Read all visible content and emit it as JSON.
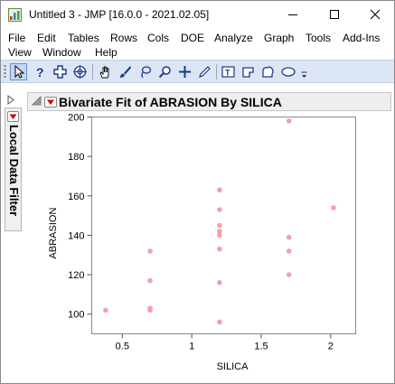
{
  "window": {
    "title": "Untitled 3 - JMP [16.0.0 - 2021.02.05]"
  },
  "menu": [
    {
      "label": "File"
    },
    {
      "label": "Edit"
    },
    {
      "label": "Tables"
    },
    {
      "label": "Rows"
    },
    {
      "label": "Cols"
    },
    {
      "label": "DOE"
    },
    {
      "label": "Analyze"
    },
    {
      "label": "Graph"
    },
    {
      "label": "Tools"
    },
    {
      "label": "Add-Ins"
    },
    {
      "label": "View"
    },
    {
      "label": "Window"
    },
    {
      "label": "Help"
    }
  ],
  "toolbar": {
    "tools": [
      "arrow-tool",
      "help-tool",
      "crosshair-tool",
      "scroller-tool",
      "grabber-tool",
      "brush-tool",
      "lasso-tool",
      "magnifier-tool",
      "crosshairs-tool",
      "line-tool",
      "annotate-tool",
      "polygon-tool",
      "simple-shape-tool",
      "ellipse-tool"
    ],
    "selected": "arrow-tool"
  },
  "side_panel": {
    "label": "Local Data Filter"
  },
  "report": {
    "title": "Bivariate Fit of ABRASION By SILICA"
  },
  "chart_data": {
    "type": "scatter",
    "xlabel": "SILICA",
    "ylabel": "ABRASION",
    "xlim": [
      0.28,
      2.18
    ],
    "ylim": [
      90,
      200
    ],
    "xticks": [
      0.5,
      1,
      1.5,
      2
    ],
    "xtick_labels": [
      "0.5",
      "1",
      "1.5",
      "2"
    ],
    "yticks": [
      100,
      120,
      140,
      160,
      180,
      200
    ],
    "ytick_labels": [
      "100",
      "120",
      "140",
      "160",
      "180",
      "200"
    ],
    "grid": false,
    "marker_color": "#f4a0aa",
    "points": [
      {
        "x": 0.38,
        "y": 102
      },
      {
        "x": 0.7,
        "y": 132
      },
      {
        "x": 0.7,
        "y": 117
      },
      {
        "x": 0.7,
        "y": 103
      },
      {
        "x": 0.7,
        "y": 102
      },
      {
        "x": 1.2,
        "y": 163
      },
      {
        "x": 1.2,
        "y": 153
      },
      {
        "x": 1.2,
        "y": 145
      },
      {
        "x": 1.2,
        "y": 142
      },
      {
        "x": 1.2,
        "y": 140
      },
      {
        "x": 1.2,
        "y": 133
      },
      {
        "x": 1.2,
        "y": 116
      },
      {
        "x": 1.2,
        "y": 96
      },
      {
        "x": 1.7,
        "y": 198
      },
      {
        "x": 1.7,
        "y": 139
      },
      {
        "x": 1.7,
        "y": 132
      },
      {
        "x": 1.7,
        "y": 120
      },
      {
        "x": 2.02,
        "y": 154
      }
    ]
  }
}
